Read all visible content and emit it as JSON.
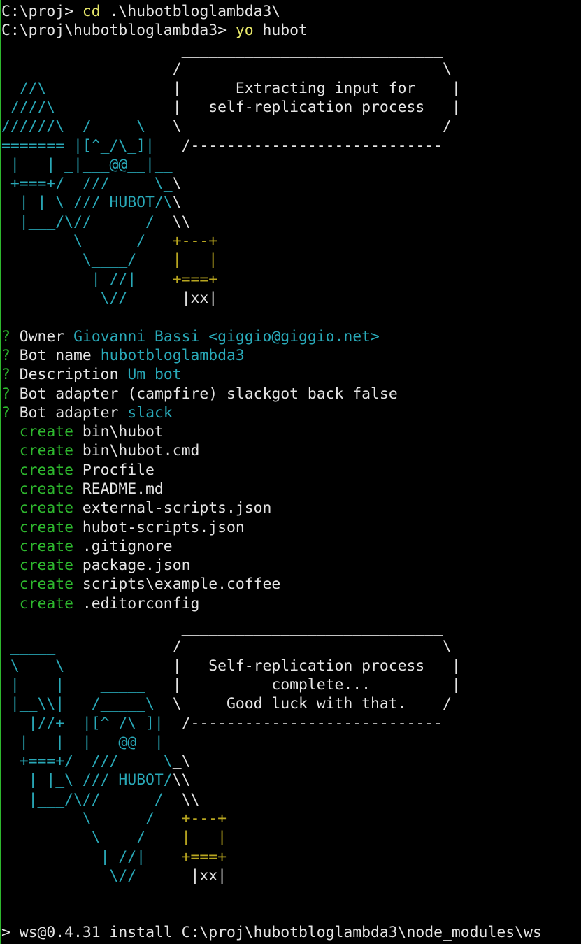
{
  "colors": {
    "background": "#000000",
    "text": "#e4e4e4",
    "command": "#e8e86a",
    "cyan": "#29a9b8",
    "green": "#2eb82e",
    "gold": "#b8a620"
  },
  "prompt_lines": [
    {
      "prompt": "C:\\proj> ",
      "cmd": "cd",
      "args": " .\\hubotbloglambda3\\"
    },
    {
      "prompt": "C:\\proj\\hubotbloglambda3> ",
      "cmd": "yo",
      "args": " hubot"
    }
  ],
  "banner_top": [
    "                    _____________________________",
    "                   /                             \\",
    "  //\\              |      Extracting input for    |",
    " ////\\    _____    |   self-replication process   |",
    "//////\\  /_____\\   \\                             /",
    "======= |[^_/\\_]|   /----------------------------",
    " |   | _|___@@__|__",
    " +===+/  ///     \\_\\",
    "  | |_\\ /// HUBOT/\\\\",
    "  |___/\\//      /  \\\\",
    "        \\      /   +---+",
    "         \\____/    |   |",
    "          | //|    +===+",
    "           \\//      |xx|"
  ],
  "questions": [
    {
      "mark": "?",
      "label": "Owner",
      "answer": "Giovanni Bassi <giggio@giggio.net>"
    },
    {
      "mark": "?",
      "label": "Bot name",
      "answer": "hubotbloglambda3"
    },
    {
      "mark": "?",
      "label": "Description",
      "answer": "Um bot"
    },
    {
      "mark": "?",
      "label": "Bot adapter",
      "answer": "(campfire) slackgot back false",
      "plain": true
    },
    {
      "mark": "?",
      "label": "Bot adapter",
      "answer": "slack"
    }
  ],
  "create_verb": "create",
  "created_files": [
    "bin\\hubot",
    "bin\\hubot.cmd",
    "Procfile",
    "README.md",
    "external-scripts.json",
    "hubot-scripts.json",
    ".gitignore",
    "package.json",
    "scripts\\example.coffee",
    ".editorconfig"
  ],
  "banner_bottom": [
    "                    _____________________________",
    " _____             /                             \\",
    " \\    \\            |   Self-replication process   |",
    " |    |    _____   |          complete...         |",
    " |__\\\\|   /_____\\  \\     Good luck with that.    /",
    "   |//+  |[^_/\\_]|  /----------------------------",
    "  |   | _|___@@__|__",
    "  +===+/  ///     \\_\\",
    "   | |_\\ /// HUBOT/\\\\",
    "   |___/\\//      /  \\\\",
    "         \\      /   +---+",
    "          \\____/    |   |",
    "           | //|    +===+",
    "            \\//      |xx|"
  ],
  "install_line": {
    "mark": ">",
    "text": " ws@0.4.31 install C:\\proj\\hubotbloglambda3\\node_modules\\ws"
  }
}
